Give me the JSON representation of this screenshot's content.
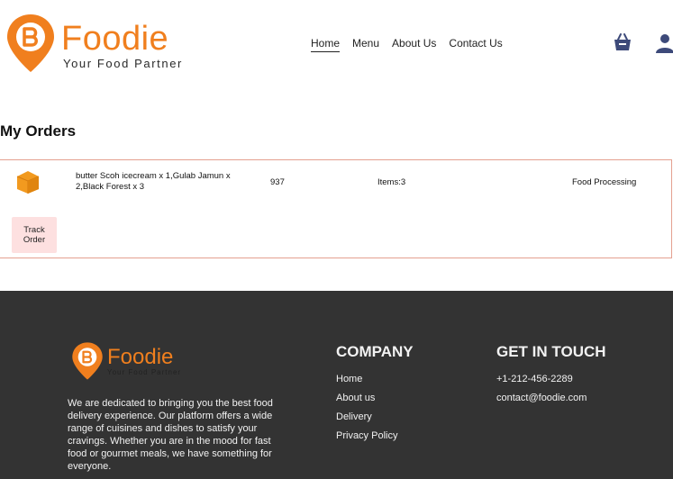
{
  "colors": {
    "accent": "#f07f1e",
    "nav_icon": "#3d4a7a",
    "footer_bg": "#333333",
    "track_btn_bg": "#fde0e0",
    "card_border": "#e4a090"
  },
  "header": {
    "brand": "Foodie",
    "tagline": "Your Food Partner",
    "nav": [
      "Home",
      "Menu",
      "About Us",
      "Contact Us"
    ],
    "active_nav": "Home",
    "icons": [
      "basket-icon",
      "user-icon"
    ]
  },
  "main": {
    "title": "My Orders",
    "orders": [
      {
        "items": "butter Scoh icecream x 1,Gulab Jamun x 2,Black Forest x 3",
        "amount": "937",
        "count": "Items:3",
        "status": "Food Processing",
        "track_label": "Track Order",
        "icon": "parcel-icon"
      }
    ]
  },
  "footer": {
    "brand": "Foodie",
    "tagline": "Your Food Partner",
    "description": "We are dedicated to bringing you the best food delivery experience. Our platform offers a wide range of cuisines and dishes to satisfy your cravings. Whether you are in the mood for fast food or gourmet meals, we have something for everyone.",
    "company_title": "COMPANY",
    "company_links": [
      "Home",
      "About us",
      "Delivery",
      "Privacy Policy"
    ],
    "contact_title": "GET IN TOUCH",
    "phone": "+1-212-456-2289",
    "email": "contact@foodie.com"
  }
}
